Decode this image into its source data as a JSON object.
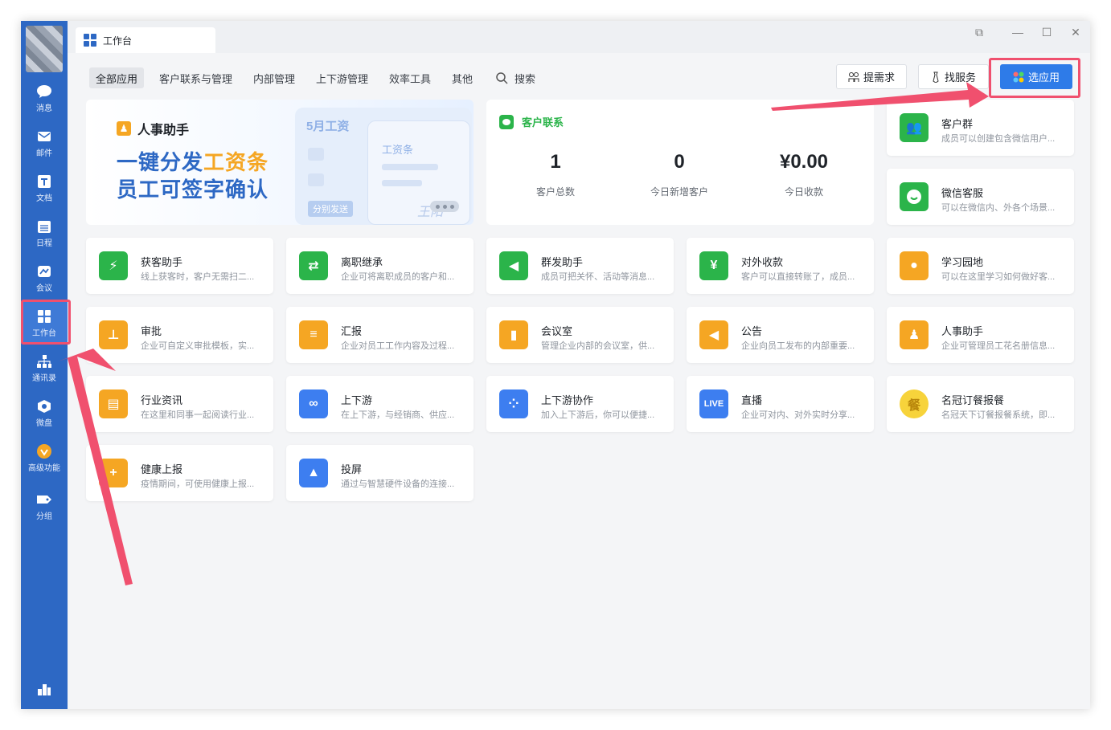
{
  "window": {
    "tab_title": "工作台",
    "controls": [
      "restore-down",
      "minimize",
      "maximize",
      "close"
    ]
  },
  "sidebar": {
    "items": [
      {
        "label": "消息",
        "icon": "chat-icon"
      },
      {
        "label": "邮件",
        "icon": "mail-icon"
      },
      {
        "label": "文档",
        "icon": "document-icon"
      },
      {
        "label": "日程",
        "icon": "calendar-icon"
      },
      {
        "label": "会议",
        "icon": "meeting-icon"
      },
      {
        "label": "工作台",
        "icon": "workbench-icon",
        "active": true
      },
      {
        "label": "通讯录",
        "icon": "contacts-icon"
      },
      {
        "label": "微盘",
        "icon": "drive-icon"
      },
      {
        "label": "高级功能",
        "icon": "premium-icon"
      },
      {
        "label": "分组",
        "icon": "tag-icon"
      }
    ],
    "bottom_icon": "chart-icon"
  },
  "categories": [
    "全部应用",
    "客户联系与管理",
    "内部管理",
    "上下游管理",
    "效率工具",
    "其他"
  ],
  "search_label": "搜索",
  "actions": {
    "request": "提需求",
    "service": "找服务",
    "choose_app": "选应用"
  },
  "banner": {
    "title": "人事助手",
    "line1_a": "一键分发",
    "line1_b": "工资条",
    "line2": "员工可签字确认",
    "month": "5月工资",
    "slip": "工资条",
    "send": "分别发送",
    "sign": "王阳"
  },
  "customer": {
    "title": "客户联系",
    "stats": [
      {
        "value": "1",
        "label": "客户总数"
      },
      {
        "value": "0",
        "label": "今日新增客户"
      },
      {
        "value": "¥0.00",
        "label": "今日收款"
      }
    ]
  },
  "side_apps": [
    {
      "name": "客户群",
      "desc": "成员可以创建包含微信用户...",
      "color": "#2bb44a",
      "icon": "group-icon"
    },
    {
      "name": "微信客服",
      "desc": "可以在微信内、外各个场景...",
      "color": "#2bb44a",
      "icon": "wechat-service-icon"
    }
  ],
  "apps": [
    {
      "name": "获客助手",
      "desc": "线上获客时，客户无需扫二...",
      "color": "#2bb44a",
      "icon": "lightning-icon",
      "glyph": "⚡"
    },
    {
      "name": "离职继承",
      "desc": "企业可将离职成员的客户和...",
      "color": "#2bb44a",
      "icon": "transfer-icon",
      "glyph": "⇄"
    },
    {
      "name": "群发助手",
      "desc": "成员可把关怀、活动等消息...",
      "color": "#2bb44a",
      "icon": "megaphone-icon",
      "glyph": "◀"
    },
    {
      "name": "对外收款",
      "desc": "客户可以直接转账了，成员...",
      "color": "#2bb44a",
      "icon": "payment-icon",
      "glyph": "¥"
    },
    {
      "name": "学习园地",
      "desc": "可以在这里学习如何做好客...",
      "color": "#f5a623",
      "icon": "planet-icon",
      "glyph": "●"
    },
    {
      "name": "审批",
      "desc": "企业可自定义审批模板，实...",
      "color": "#f5a623",
      "icon": "stamp-icon",
      "glyph": "⊥"
    },
    {
      "name": "汇报",
      "desc": "企业对员工工作内容及过程...",
      "color": "#f5a623",
      "icon": "report-icon",
      "glyph": "≡"
    },
    {
      "name": "会议室",
      "desc": "管理企业内部的会议室，供...",
      "color": "#f5a623",
      "icon": "door-icon",
      "glyph": "▮"
    },
    {
      "name": "公告",
      "desc": "企业向员工发布的内部重要...",
      "color": "#f5a623",
      "icon": "announce-icon",
      "glyph": "◀"
    },
    {
      "name": "人事助手",
      "desc": "企业可管理员工花名册信息...",
      "color": "#f5a623",
      "icon": "person-icon",
      "glyph": "♟"
    },
    {
      "name": "行业资讯",
      "desc": "在这里和同事一起阅读行业...",
      "color": "#f5a623",
      "icon": "news-icon",
      "glyph": "▤"
    },
    {
      "name": "上下游",
      "desc": "在上下游，与经销商、供应...",
      "color": "#3d7ef0",
      "icon": "link-icon",
      "glyph": "∞"
    },
    {
      "name": "上下游协作",
      "desc": "加入上下游后，你可以便捷...",
      "color": "#3d7ef0",
      "icon": "grid-icon",
      "glyph": "⁘"
    },
    {
      "name": "直播",
      "desc": "企业可对内、对外实时分享...",
      "color": "#3d7ef0",
      "icon": "live-icon",
      "glyph": "LIVE"
    },
    {
      "name": "名冠订餐报餐",
      "desc": "名冠天下订餐报餐系统，即...",
      "color": "#f7d33b",
      "icon": "meal-icon",
      "glyph": "餐"
    },
    {
      "name": "健康上报",
      "desc": "疫情期间，可使用健康上报...",
      "color": "#f5a623",
      "icon": "clipboard-plus-icon",
      "glyph": "+"
    },
    {
      "name": "投屏",
      "desc": "通过与智慧硬件设备的连接...",
      "color": "#3d7ef0",
      "icon": "screen-cast-icon",
      "glyph": "▲"
    }
  ]
}
